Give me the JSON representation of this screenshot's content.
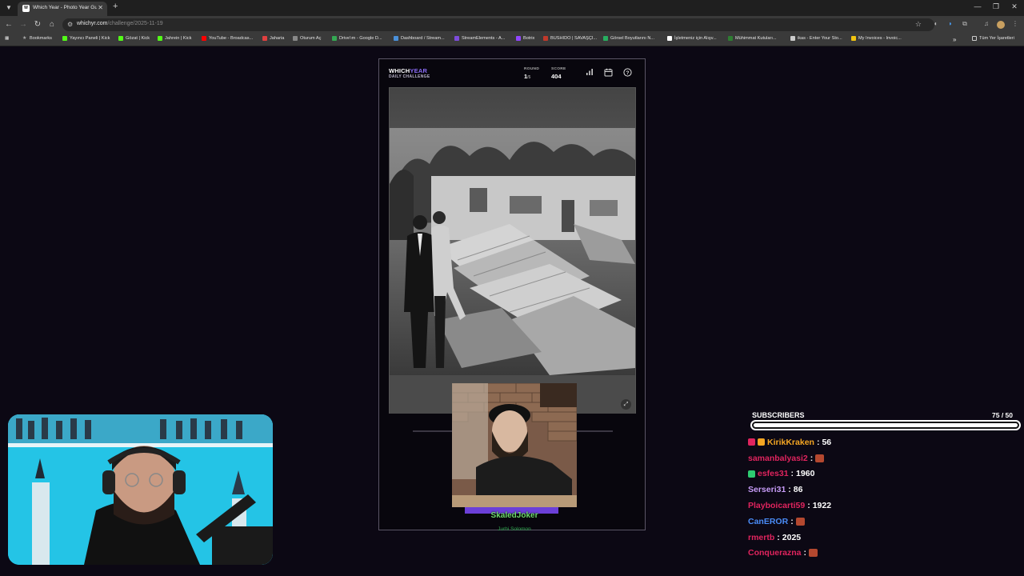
{
  "browser": {
    "tab_title": "Which Year - Photo Year Guess",
    "url_host": "whichyr.com",
    "url_path": "/challenge/2025-11-19",
    "bookmarks": [
      {
        "label": "Bookmarks",
        "color": "#aaaaaa"
      },
      {
        "label": "Yayıncı Paneli | Kick",
        "color": "#53fc18"
      },
      {
        "label": "Gözat | Kick",
        "color": "#53fc18"
      },
      {
        "label": "Jahrein | Kick",
        "color": "#53fc18"
      },
      {
        "label": "YouTube - Broadcas...",
        "color": "#ff0000"
      },
      {
        "label": "Jaharia",
        "color": "#e04040"
      },
      {
        "label": "Oturum Aç",
        "color": "#888888"
      },
      {
        "label": "Drive'ım - Google D...",
        "color": "#34a853"
      },
      {
        "label": "Dashboard / Stream...",
        "color": "#4a90d9"
      },
      {
        "label": "StreamElements - A...",
        "color": "#7d4cdb"
      },
      {
        "label": "Botrix",
        "color": "#9146ff"
      },
      {
        "label": "BUSHIDO | SAVAŞÇI...",
        "color": "#c0392b"
      },
      {
        "label": "Görsel Boyutlarını N...",
        "color": "#27ae60"
      },
      {
        "label": "İşletmeniz için Alışv...",
        "color": "#ffffff"
      },
      {
        "label": "Mühimmat Kutuları...",
        "color": "#2e7d32"
      },
      {
        "label": "ikas - Enter Your Sto...",
        "color": "#cccccc"
      },
      {
        "label": "My Invoices - Invoic...",
        "color": "#f1c40f"
      }
    ],
    "all_bookmarks_label": "Tüm Yer İşaretleri"
  },
  "game": {
    "logo_a": "WHICH",
    "logo_b": "YEAR",
    "logo_sub": "DAILY CHALLENGE",
    "round_label": "ROUND",
    "round_value": "1",
    "round_total": "/5",
    "score_label": "SCORE",
    "score_value": "404",
    "icons": [
      "stats-icon",
      "calendar-icon",
      "help-icon"
    ]
  },
  "guest": {
    "name": "SkaledJoker",
    "subtitle": "Jurhi Solomon"
  },
  "subscribers": {
    "label": "SUBSCRIBERS",
    "count_text": "75 / 50",
    "progress": 1.0
  },
  "chat": [
    {
      "user": "KirikKraken",
      "color": "#f5a623",
      "msg": "56",
      "badges": [
        "#e0245e",
        "#f5a623"
      ]
    },
    {
      "user": "samanbalyasi2",
      "color": "#e0245e",
      "msg": "",
      "emote": true
    },
    {
      "user": "esfes31",
      "color": "#e0245e",
      "msg": "1960",
      "badges": [
        "#2ecc71"
      ]
    },
    {
      "user": "Serseri31",
      "color": "#c79cf7",
      "msg": "86"
    },
    {
      "user": "Playboicarti59",
      "color": "#e0245e",
      "msg": "1922"
    },
    {
      "user": "CanEROR",
      "color": "#4a8cf7",
      "msg": "",
      "emote": true
    },
    {
      "user": "rmertb",
      "color": "#e0245e",
      "msg": "2025"
    },
    {
      "user": "Conquerazna",
      "color": "#e0245e",
      "msg": "",
      "emote": true
    }
  ]
}
